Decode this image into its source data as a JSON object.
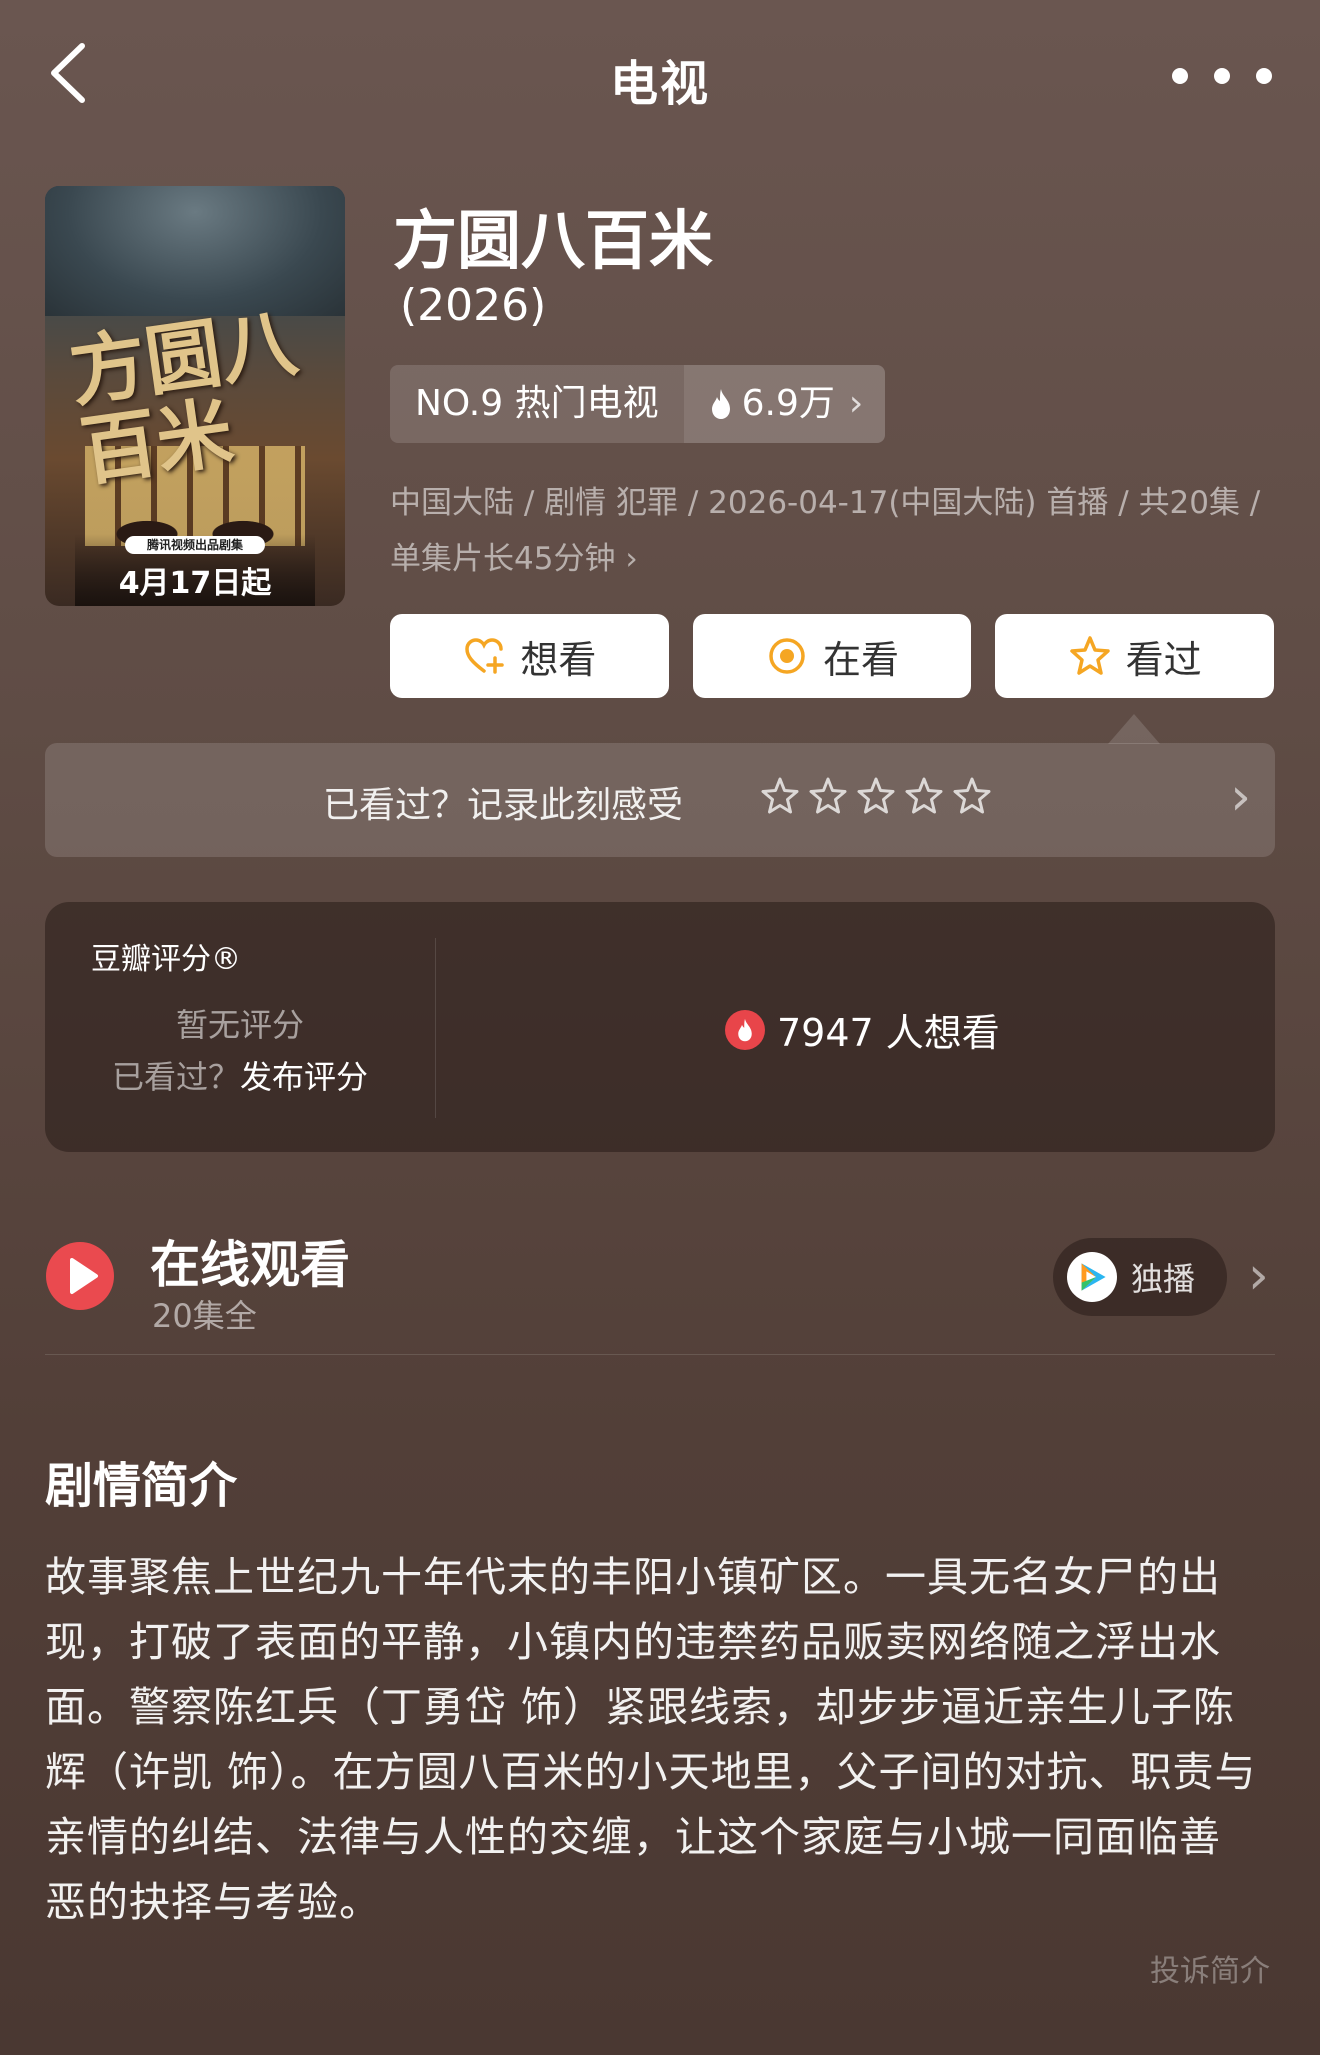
{
  "nav": {
    "title": "电视"
  },
  "poster": {
    "title": "方圆八百米",
    "badge": "腾讯视频出品剧集",
    "date": "4月17日起"
  },
  "show": {
    "title": "方圆八百米",
    "year": "(2026)",
    "rank_label": "NO.9 热门电视",
    "heat": "6.9万",
    "meta": "中国大陆 / 剧情 犯罪 / 2026-04-17(中国大陆) 首播 / 共20集 / 单集片长45分钟",
    "meta_chevron": "›"
  },
  "actions": {
    "want": "想看",
    "watching": "在看",
    "watched": "看过"
  },
  "prompt": {
    "text": "已看过？记录此刻感受",
    "chevron": "›"
  },
  "douban": {
    "label": "豆瓣评分®",
    "no_rating": "暂无评分",
    "seen_q": "已看过？",
    "publish": "发布评分",
    "want_count": "7947 人想看"
  },
  "watch": {
    "title": "在线观看",
    "subtitle": "20集全",
    "platform_label": "独播",
    "chevron": "›"
  },
  "synopsis": {
    "heading": "剧情简介",
    "body": "故事聚焦上世纪九十年代末的丰阳小镇矿区。一具无名女尸的出现，打破了表面的平静，小镇内的违禁药品贩卖网络随之浮出水面。警察陈红兵（丁勇岱 饰）紧跟线索，却步步逼近亲生儿子陈辉（许凯 饰）。在方圆八百米的小天地里，父子间的对抗、职责与亲情的纠结、法律与人性的交缠，让这个家庭与小城一同面临善恶的抉择与考验。",
    "report": "投诉简介"
  },
  "colors": {
    "accent_red": "#ea4a4f",
    "star_orange": "#f5a623",
    "bg_top": "#6a5650",
    "bg_bottom": "#4a3832"
  },
  "icons": {
    "back": "back-arrow-icon",
    "more": "more-dots-icon",
    "heat": "flame-icon",
    "want": "heart-plus-icon",
    "watching": "target-circle-icon",
    "watched": "star-icon",
    "play": "play-icon",
    "platform": "tencent-video-icon"
  }
}
